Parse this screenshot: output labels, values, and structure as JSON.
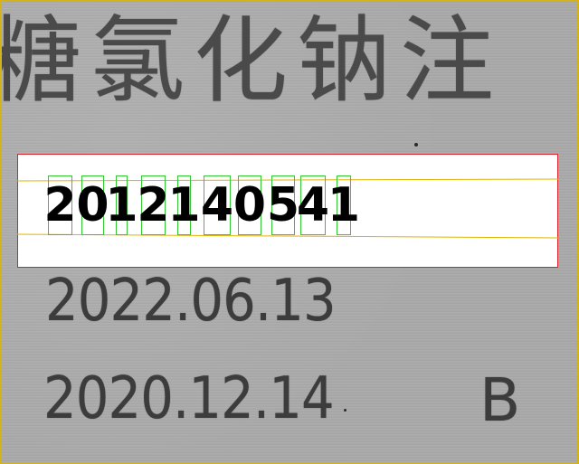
{
  "image": {
    "printed_lines": {
      "chinese_header": "糖氯化钠注",
      "date_line_1": "2022.06.13",
      "date_line_2": "2020.12.14",
      "batch_letter": "B"
    }
  },
  "ocr": {
    "roi_color": "#e0202a",
    "char_box_color": "#32c832",
    "baseline_color": "#e0b400",
    "recognized_chars": [
      "2",
      "0",
      "1",
      "2",
      "1",
      "4",
      "0",
      "5",
      "4",
      "1"
    ]
  },
  "frame_color": "#d4b21a"
}
